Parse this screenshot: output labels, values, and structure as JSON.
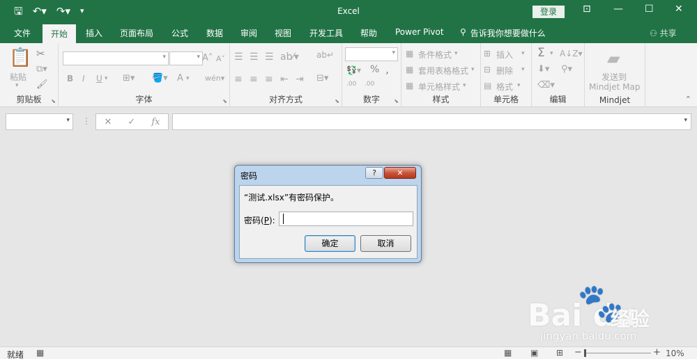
{
  "window": {
    "title": "Excel",
    "login_label": "登录",
    "qat_icons": [
      "save-icon",
      "undo-icon",
      "redo-icon",
      "customize-qat-icon"
    ],
    "controls": [
      "ribbon-display-icon",
      "minimize-icon",
      "maximize-icon",
      "close-icon"
    ]
  },
  "tabs": [
    "文件",
    "开始",
    "插入",
    "页面布局",
    "公式",
    "数据",
    "审阅",
    "视图",
    "开发工具",
    "帮助",
    "Power Pivot"
  ],
  "active_tab": "开始",
  "tell_me": "告诉我你想要做什么",
  "share_label": "共享",
  "ribbon": {
    "clipboard": {
      "label": "剪贴板",
      "paste": "粘贴"
    },
    "font": {
      "label": "字体",
      "bold": "B",
      "italic": "I",
      "underline": "U",
      "font_color": "A"
    },
    "alignment": {
      "label": "对齐方式"
    },
    "number": {
      "label": "数字",
      "percent": "%",
      "comma": ",",
      "inc_dec": ".00",
      "dec_dec": ".00"
    },
    "styles": {
      "label": "样式",
      "conditional": "条件格式",
      "table": "套用表格格式",
      "cell_styles": "单元格样式"
    },
    "cells": {
      "label": "单元格",
      "insert": "插入",
      "delete": "删除",
      "format": "格式"
    },
    "editing": {
      "label": "编辑",
      "autosum": "Σ"
    },
    "mindjet": {
      "label": "Mindjet",
      "send_line1": "发送到",
      "send_line2": "Mindjet Map"
    }
  },
  "formula_bar": {
    "cancel": "✕",
    "enter": "✓",
    "fx": "fx"
  },
  "dialog": {
    "title": "密码",
    "help": "?",
    "close": "✕",
    "message": "“测试.xlsx”有密码保护。",
    "password_label_pre": "密码(",
    "password_label_key": "P",
    "password_label_post": "):",
    "password_value": "",
    "ok": "确定",
    "cancel": "取消"
  },
  "watermark": {
    "logo": "Bai  du",
    "cn": "经验",
    "url": "jingyan.baidu.com"
  },
  "status": {
    "ready": "就绪",
    "zoom": "10%"
  }
}
